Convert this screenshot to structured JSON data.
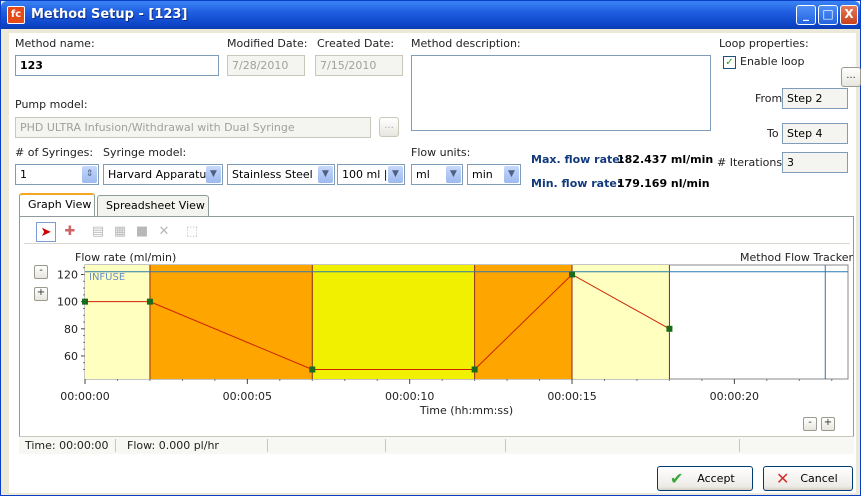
{
  "window": {
    "title": "Method Setup - [123]",
    "icon_text": "fc"
  },
  "title_buttons": {
    "minimize": "_",
    "maximize": "□",
    "close": "X"
  },
  "form": {
    "method_name_label": "Method name:",
    "method_name_value": "123",
    "modified_label": "Modified Date:",
    "modified_value": "7/28/2010",
    "created_label": "Created Date:",
    "created_value": "7/15/2010",
    "description_label": "Method description:",
    "description_value": "",
    "pump_label": "Pump model:",
    "pump_value": "PHD ULTRA Infusion/Withdrawal with Dual Syringe",
    "pump_browse": "...",
    "syringes_label": "# of Syringes:",
    "syringes_value": "1",
    "syringe_model_label": "Syringe model:",
    "syringe_brand": "Harvard Apparatus",
    "syringe_material": "Stainless Steel",
    "syringe_size": "100 ml | :",
    "flow_units_label": "Flow units:",
    "flow_unit_vol": "ml",
    "flow_unit_time": "min"
  },
  "rates": {
    "max_label": "Max. flow rate:",
    "max_value": "182.437 ml/min",
    "min_label": "Min. flow rate:",
    "min_value": "179.169 nl/min"
  },
  "loop": {
    "title": "Loop properties:",
    "enable_label": "Enable loop",
    "enabled": true,
    "browse": "...",
    "from_label": "From",
    "from_value": "Step 2",
    "to_label": "To",
    "to_value": "Step 4",
    "iterations_label": "# Iterations",
    "iterations_value": "3"
  },
  "tabs": [
    {
      "label": "Graph View"
    },
    {
      "label": "Spreadsheet View"
    }
  ],
  "toolbar_icons": [
    "select-arrow-icon",
    "add-step-icon",
    "copy-step-icon",
    "insert-step-icon",
    "fill-step-icon",
    "delete-step-icon",
    "zoom-select-icon"
  ],
  "chart_data": {
    "type": "line",
    "ylabel": "Flow rate (ml/min)",
    "xlabel": "Time (hh:mm:ss)",
    "tracker_label": "Method Flow Tracker",
    "series_label": "INFUSE",
    "y_ticks": [
      "60",
      "80",
      "100",
      "120"
    ],
    "x_ticks": [
      "00:00:00",
      "00:00:05",
      "00:00:10",
      "00:00:15",
      "00:00:20"
    ],
    "ylim": [
      43,
      127
    ],
    "xlim": [
      0,
      23.5
    ],
    "x_seconds": [
      0,
      2,
      7,
      12,
      15,
      18
    ],
    "y": [
      100,
      100,
      50,
      50,
      120,
      80
    ],
    "steps": [
      {
        "start": 0,
        "end": 2,
        "color": "#ffffc0"
      },
      {
        "start": 2,
        "end": 7,
        "color": "#ffa500"
      },
      {
        "start": 7,
        "end": 12,
        "color": "#f0f000"
      },
      {
        "start": 12,
        "end": 15,
        "color": "#ffa500"
      },
      {
        "start": 15,
        "end": 18,
        "color": "#ffffc0"
      }
    ],
    "tracker_time": 22.8,
    "reference_y": 122,
    "line_color": "#cc2200",
    "point_color": "#1a6b1a"
  },
  "zoom": {
    "y_minus": "-",
    "y_plus": "+",
    "x_minus": "-",
    "x_plus": "+"
  },
  "status": {
    "time": "Time: 00:00:00",
    "flow": "Flow: 0.000 pl/hr"
  },
  "buttons": {
    "accept": "Accept",
    "cancel": "Cancel"
  }
}
